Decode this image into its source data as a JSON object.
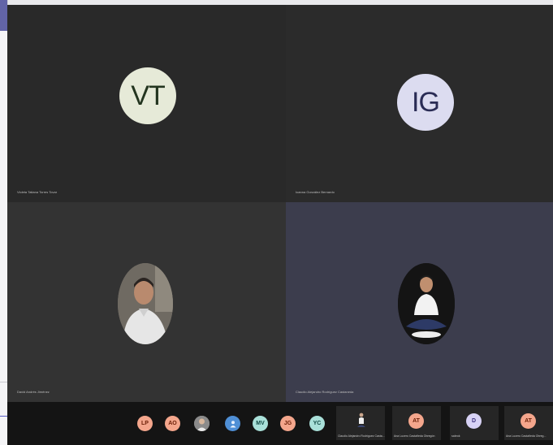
{
  "tiles": [
    {
      "initials": "VT",
      "name": "Violeta Tatiana Torres Tovar",
      "kind": "initials"
    },
    {
      "initials": "IG",
      "name": "Ioanna González Bernardo",
      "kind": "initials"
    },
    {
      "initials": "",
      "name": "David Andrés Jiménez",
      "kind": "video"
    },
    {
      "initials": "",
      "name": "Claudio Alejandro Rodríguez Castaneda",
      "kind": "video"
    }
  ],
  "roster": {
    "chips": [
      {
        "initials": "LP",
        "color": "#f4a68c"
      },
      {
        "initials": "AO",
        "color": "#f4a68c"
      },
      {
        "initials": "",
        "color": "#8b8b8b"
      },
      {
        "initials": "",
        "color": "#4f8fd6"
      },
      {
        "initials": "MV",
        "color": "#a9e0d9"
      },
      {
        "initials": "JG",
        "color": "#f4a68c"
      },
      {
        "initials": "YC",
        "color": "#a9e0d9"
      }
    ],
    "cards": [
      {
        "initials": "",
        "label": "Claudio Alejandro Rodríguez Casta..."
      },
      {
        "initials": "AT",
        "label": "Ana Lucero Castañeda Obregón"
      },
      {
        "initials": "D",
        "label": "sabrok"
      },
      {
        "initials": "AT",
        "label": "Ana Lucero Castañeda Obreg..."
      }
    ]
  },
  "colors": {
    "background": "#1f1f1f",
    "accent": "#6264a7"
  }
}
